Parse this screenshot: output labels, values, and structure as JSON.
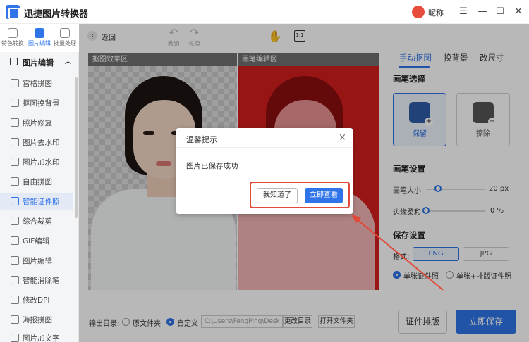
{
  "app": {
    "title": "迅捷图片转换器",
    "user_name": "昵称"
  },
  "window_controls": {
    "menu": "☰",
    "minimize": "—",
    "maximize": "☐",
    "close": "✕"
  },
  "top_nav": [
    {
      "label": "特色转换",
      "icon": "swap-icon"
    },
    {
      "label": "图片编辑",
      "icon": "image-edit-icon",
      "active": true
    },
    {
      "label": "批量处理",
      "icon": "batch-icon"
    }
  ],
  "sidebar": {
    "header": "图片编辑",
    "items": [
      {
        "label": "宫格拼图",
        "icon": "grid-icon"
      },
      {
        "label": "抠图换背景",
        "icon": "cutout-icon"
      },
      {
        "label": "照片修复",
        "icon": "repair-icon"
      },
      {
        "label": "图片去水印",
        "icon": "remove-watermark-icon"
      },
      {
        "label": "图片加水印",
        "icon": "add-watermark-icon"
      },
      {
        "label": "自由拼图",
        "icon": "collage-icon"
      },
      {
        "label": "智能证件照",
        "icon": "id-photo-icon",
        "active": true
      },
      {
        "label": "综合裁剪",
        "icon": "crop-icon"
      },
      {
        "label": "GIF编辑",
        "icon": "gif-icon"
      },
      {
        "label": "图片编辑",
        "icon": "edit-icon"
      },
      {
        "label": "智能消除笔",
        "icon": "eraser-pen-icon"
      },
      {
        "label": "修改DPI",
        "icon": "dpi-icon"
      },
      {
        "label": "海报拼图",
        "icon": "poster-icon"
      },
      {
        "label": "图片加文字",
        "icon": "text-icon"
      }
    ]
  },
  "toolbar": {
    "back": "返回",
    "undo": "撤销",
    "redo": "恢复"
  },
  "panels": {
    "left_label": "抠图效果区",
    "right_label": "画笔编辑区"
  },
  "right_tabs": [
    "手动抠图",
    "换背景",
    "改尺寸"
  ],
  "brush": {
    "select_title": "画笔选择",
    "keep": "保留",
    "erase": "擦除",
    "settings_title": "画笔设置",
    "size_label": "画笔大小",
    "size_value": "20 px",
    "size_fraction": 0.2,
    "soft_label": "边缘柔和",
    "soft_value": "0 %",
    "soft_fraction": 0.0
  },
  "save_settings": {
    "title": "保存设置",
    "format_label": "格式:",
    "formats": [
      "PNG",
      "JPG"
    ],
    "selected_format": "PNG",
    "options": [
      "单张证件照",
      "单张+排版证件照"
    ],
    "selected_option": "单张证件照"
  },
  "bottom": {
    "output_label": "输出目录:",
    "source_folder": "原文件夹",
    "custom": "自定义",
    "path": "C:\\Users\\FengPing\\Desk",
    "change_dir": "更改目录",
    "open_folder": "打开文件夹",
    "id_layout": "证件排版",
    "save_now": "立即保存"
  },
  "dialog": {
    "title": "温馨提示",
    "close": "×",
    "message": "图片已保存成功",
    "btn_know": "我知道了",
    "btn_view": "立即查看"
  },
  "colors": {
    "accent": "#2f74e8",
    "highlight": "#e04a3a",
    "bg_red": "#d31e1e"
  }
}
